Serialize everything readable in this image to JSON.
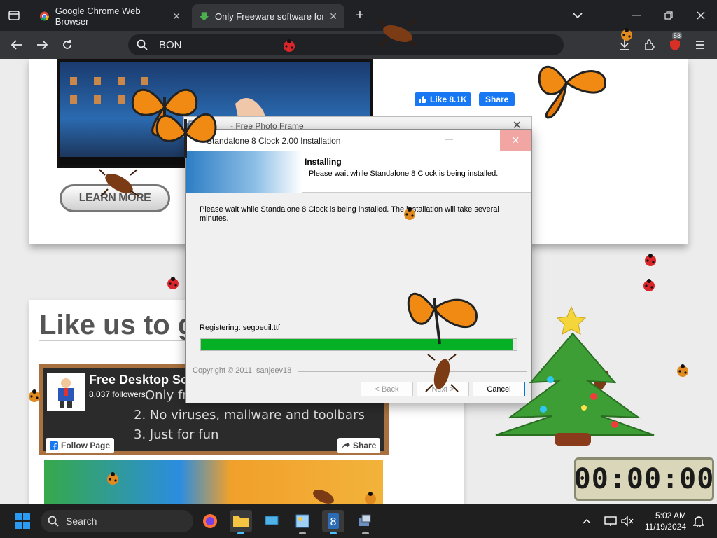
{
  "browser": {
    "tabs": [
      {
        "title": "Google Chrome Web Browser"
      },
      {
        "title": "Only Freeware software for you"
      }
    ],
    "address": "BON",
    "downloads_badge": "58"
  },
  "page": {
    "learn_more": "LEARN MORE",
    "fb_like": "Like 8.1K",
    "fb_share": "Share",
    "like_us_title": "Like us to g",
    "fb_page": {
      "name": "Free Desktop Sof",
      "followers": "8,037 followers",
      "follow_btn": "Follow Page",
      "share_btn": "Share",
      "chalk_lines": [
        "Only fre",
        "2. No viruses, mallware and toolbars",
        "3. Just for fun"
      ]
    }
  },
  "background_dialog": {
    "title": "- Free Photo Frame"
  },
  "installer": {
    "title": "Standalone 8 Clock 2.00 Installation",
    "header_title": "Installing",
    "header_subtitle": "Please wait while Standalone 8 Clock is being installed.",
    "body_text": "Please wait while Standalone 8 Clock is being installed. The installation will take several minutes.",
    "status": "Registering: segoeuil.ttf",
    "progress_percent": 99,
    "copyright": "Copyright © 2011, sanjeev18",
    "back_label": "< Back",
    "next_label": "Next >",
    "cancel_label": "Cancel"
  },
  "clock_widget": {
    "display": "00:00:00"
  },
  "taskbar": {
    "search_label": "Search",
    "time": "5:02 AM",
    "date": "11/19/2024"
  },
  "colors": {
    "progress": "#06b025",
    "facebook": "#1877f2"
  }
}
